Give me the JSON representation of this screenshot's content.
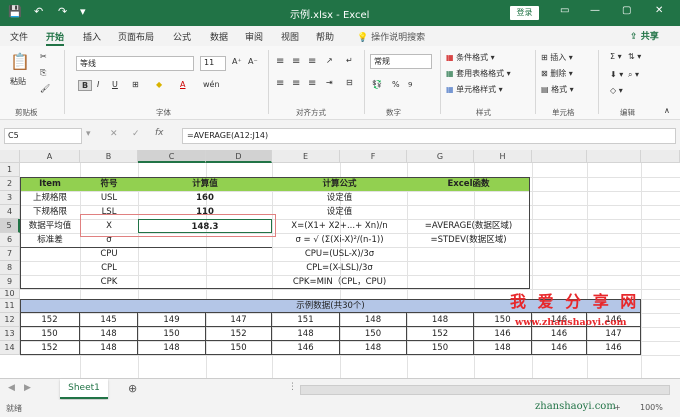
{
  "window": {
    "title": "示例.xlsx  -  Excel",
    "login": "登录"
  },
  "quick_access": {
    "save": "💾",
    "undo": "↶",
    "redo": "↷",
    "more": "▾"
  },
  "window_controls": {
    "ribbon_opts": "▭",
    "minimize": "—",
    "restore": "▢",
    "close": "✕"
  },
  "ribbon_tabs": [
    "文件",
    "开始",
    "插入",
    "页面布局",
    "公式",
    "数据",
    "审阅",
    "视图",
    "帮助",
    "操作说明搜索"
  ],
  "share": "共享",
  "clipboard": {
    "paste": "粘贴",
    "label": "剪贴板"
  },
  "font": {
    "name": "等线",
    "size": "11",
    "label": "字体",
    "bold": "B",
    "italic": "I",
    "underline": "U",
    "wen": "wén"
  },
  "alignment": {
    "label": "对齐方式"
  },
  "number": {
    "format": "常规",
    "label": "数字",
    "percent": "%"
  },
  "styles": {
    "cond": "条件格式",
    "table": "套用表格格式",
    "cell": "单元格样式",
    "label": "样式"
  },
  "cells": {
    "insert": "插入",
    "delete": "删除",
    "format": "格式",
    "label": "单元格"
  },
  "editing": {
    "label": "编辑"
  },
  "formula_bar": {
    "name_box": "C5",
    "fx": "fx",
    "formula": "=AVERAGE(A12:J14)"
  },
  "columns": [
    "A",
    "B",
    "C",
    "D",
    "E",
    "F",
    "G",
    "H",
    "I",
    "J",
    "K"
  ],
  "rows": [
    "1",
    "2",
    "3",
    "4",
    "5",
    "6",
    "7",
    "8",
    "9",
    "10",
    "11",
    "12",
    "13",
    "14"
  ],
  "cells_data": {
    "r2": [
      "Item",
      "符号",
      "计算值",
      "计算公式",
      "Excel函数"
    ],
    "r3": [
      "上规格限",
      "USL",
      "160",
      "设定值"
    ],
    "r4": [
      "下规格限",
      "LSL",
      "110",
      "设定值"
    ],
    "r5": [
      "数据平均值",
      "X",
      "148.3",
      "X=(X1+ X2+...+ Xn)/n",
      "=AVERAGE(数据区域)"
    ],
    "r6": [
      "标准差",
      "σ",
      "σ = √ (Σ(Xi-X)²/(n-1))",
      "=STDEV(数据区域)"
    ],
    "r7": [
      "CPU",
      "CPU=(USL-X)/3σ"
    ],
    "r8": [
      "CPL",
      "CPL=(X-LSL)/3σ"
    ],
    "r9": [
      "CPK",
      "CPK=MIN（CPL，CPU)"
    ],
    "r11": "示例数据(共30个)",
    "r12": [
      "152",
      "145",
      "149",
      "147",
      "151",
      "148",
      "148",
      "150",
      "146",
      "146"
    ],
    "r13": [
      "150",
      "148",
      "150",
      "152",
      "148",
      "150",
      "152",
      "146",
      "146",
      "147"
    ],
    "r14": [
      "152",
      "148",
      "148",
      "150",
      "146",
      "148",
      "150",
      "148",
      "146",
      "146"
    ]
  },
  "watermark": {
    "main": "我 爱 分 享 网",
    "url": "www.zhanshaoyi.com",
    "status_url": "zhanshaoyi.com"
  },
  "sheet": {
    "tab": "Sheet1",
    "add": "⊕"
  },
  "status": {
    "ready": "就绪",
    "zoom": "100%"
  }
}
